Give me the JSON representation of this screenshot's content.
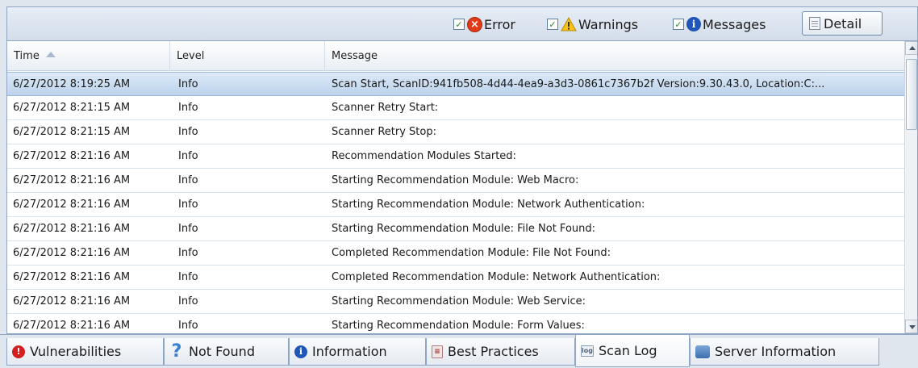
{
  "toolbar": {
    "error": {
      "label": "Error",
      "checked": true,
      "icon": "error-circle-icon"
    },
    "warnings": {
      "label": "Warnings",
      "checked": true,
      "icon": "warning-triangle-icon"
    },
    "messages": {
      "label": "Messages",
      "checked": true,
      "icon": "info-circle-icon"
    },
    "detail_label": "Detail"
  },
  "grid": {
    "columns": {
      "time": "Time",
      "level": "Level",
      "message": "Message"
    },
    "sort": {
      "column": "Time",
      "direction": "ascending"
    },
    "selected_row": 0,
    "rows": [
      {
        "time": "6/27/2012 8:19:25 AM",
        "level": "Info",
        "message": "Scan Start, ScanID:941fb508-4d44-4ea9-a3d3-0861c7367b2f Version:9.30.43.0, Location:C:..."
      },
      {
        "time": "6/27/2012 8:21:15 AM",
        "level": "Info",
        "message": "Scanner Retry Start:"
      },
      {
        "time": "6/27/2012 8:21:15 AM",
        "level": "Info",
        "message": "Scanner Retry Stop:"
      },
      {
        "time": "6/27/2012 8:21:16 AM",
        "level": "Info",
        "message": "Recommendation Modules Started:"
      },
      {
        "time": "6/27/2012 8:21:16 AM",
        "level": "Info",
        "message": "Starting Recommendation Module: Web Macro:"
      },
      {
        "time": "6/27/2012 8:21:16 AM",
        "level": "Info",
        "message": "Starting Recommendation Module: Network Authentication:"
      },
      {
        "time": "6/27/2012 8:21:16 AM",
        "level": "Info",
        "message": "Starting Recommendation Module: File Not Found:"
      },
      {
        "time": "6/27/2012 8:21:16 AM",
        "level": "Info",
        "message": "Completed Recommendation Module: File Not Found:"
      },
      {
        "time": "6/27/2012 8:21:16 AM",
        "level": "Info",
        "message": "Completed Recommendation Module: Network Authentication:"
      },
      {
        "time": "6/27/2012 8:21:16 AM",
        "level": "Info",
        "message": "Starting Recommendation Module: Web Service:"
      },
      {
        "time": "6/27/2012 8:21:16 AM",
        "level": "Info",
        "message": "Starting Recommendation Module: Form Values:"
      }
    ]
  },
  "tabs": [
    {
      "label": "Vulnerabilities",
      "icon": "vulnerabilities-icon",
      "active": false
    },
    {
      "label": "Not Found",
      "icon": "question-icon",
      "active": false
    },
    {
      "label": "Information",
      "icon": "info-icon",
      "active": false
    },
    {
      "label": "Best Practices",
      "icon": "best-practices-icon",
      "active": false
    },
    {
      "label": "Scan Log",
      "icon": "scan-log-icon",
      "active": true
    },
    {
      "label": "Server Information",
      "icon": "server-icon",
      "active": false
    }
  ],
  "colors": {
    "error": "#e03a18",
    "info": "#1f56b8",
    "selection": "#bcd3ec",
    "border": "#8ea6c3"
  }
}
